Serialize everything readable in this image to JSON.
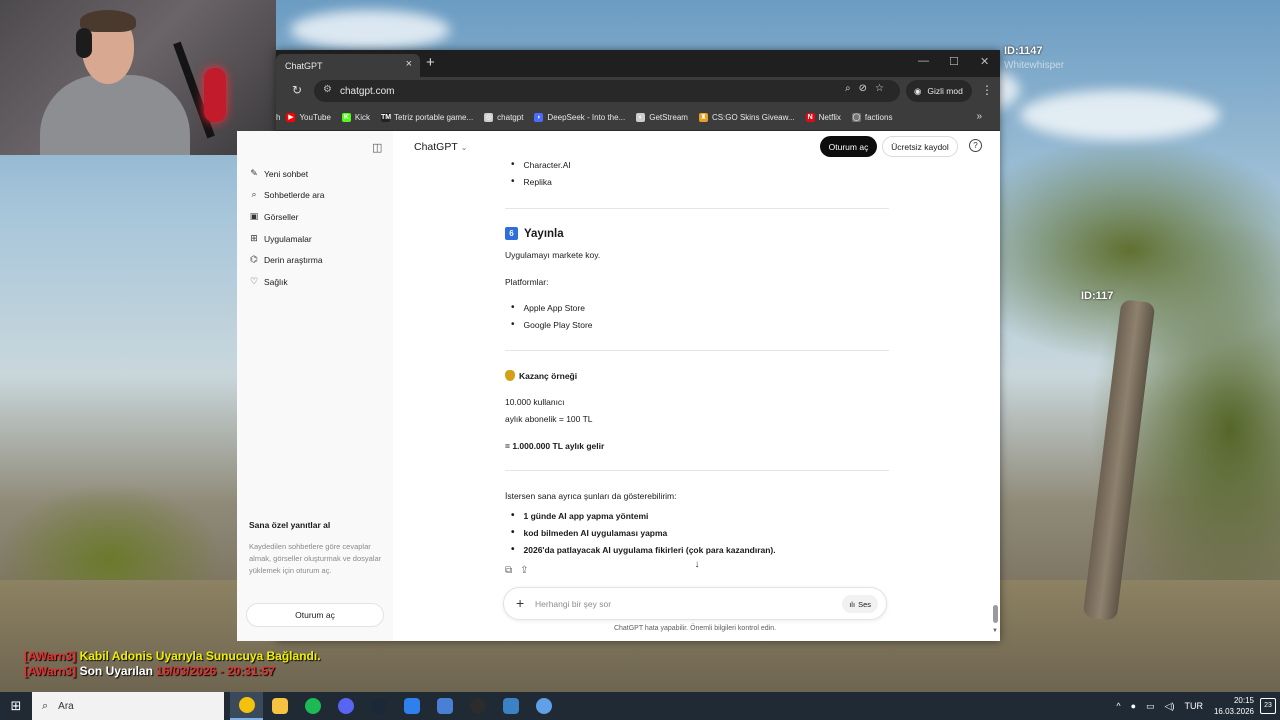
{
  "overlays": {
    "id_top": "ID:1147",
    "id_top_sub": "Whitewhisper",
    "id_right": "ID:117",
    "log_tag_1": "[AWarn3]",
    "log_msg_1": "Kabil Adonis Uyarıyla Sunucuya Bağlandı.",
    "log_tag_2": "[AWarn3]",
    "log_msg_2": "Son Uyarılan",
    "log_date_2": "16/03/2026 - 20:31:57"
  },
  "browser": {
    "tab_title": "ChatGPT",
    "url": "chatgpt.com",
    "incognito_label": "Gizli mod",
    "bookmarks": [
      {
        "label": "YouTube",
        "color": "#ff0000",
        "glyph": "▶"
      },
      {
        "label": "Kick",
        "color": "#53fc18",
        "glyph": "K"
      },
      {
        "label": "Tetriz portable game...",
        "color": "#222222",
        "glyph": "TM"
      },
      {
        "label": "chatgpt",
        "color": "#cccccc",
        "glyph": "◎"
      },
      {
        "label": "DeepSeek - Into the...",
        "color": "#4d6bfe",
        "glyph": "◗"
      },
      {
        "label": "GetStream",
        "color": "#cccccc",
        "glyph": "◐"
      },
      {
        "label": "CS:GO Skins Giveaw...",
        "color": "#e8a020",
        "glyph": "♜"
      },
      {
        "label": "Netflix",
        "color": "#e50914",
        "glyph": "N"
      },
      {
        "label": "factions",
        "color": "#777777",
        "glyph": "◯"
      }
    ]
  },
  "chatgpt": {
    "model": "ChatGPT",
    "login_button": "Oturum aç",
    "signup_button": "Ücretsiz kaydol",
    "sidebar": {
      "items": [
        {
          "label": "Yeni sohbet",
          "icon": "✎"
        },
        {
          "label": "Sohbetlerde ara",
          "icon": "⌕"
        },
        {
          "label": "Görseller",
          "icon": "▣"
        },
        {
          "label": "Uygulamalar",
          "icon": "⊞"
        },
        {
          "label": "Derin araştırma",
          "icon": "⌬"
        },
        {
          "label": "Sağlık",
          "icon": "♡"
        }
      ],
      "promo_title": "Sana özel yanıtlar al",
      "promo_text": "Kaydedilen sohbetlere göre cevaplar almak, görseller oluşturmak ve dosyalar yüklemek için oturum aç.",
      "login_button": "Oturum aç"
    },
    "message": {
      "top_bullets": [
        "Character.AI",
        "Replika"
      ],
      "section6_badge": "6",
      "section6_title": "Yayınla",
      "section6_text": "Uygulamayı markete koy.",
      "platforms_label": "Platformlar:",
      "platform_bullets": [
        "Apple App Store",
        "Google Play Store"
      ],
      "earnings_title": "Kazanç örneği",
      "earnings_line1": "10.000 kullanıcı",
      "earnings_line2": "aylık abonelik = 100 TL",
      "earnings_result": "= 1.000.000 TL aylık gelir",
      "offer_intro": "İstersen sana ayrıca şunları da gösterebilirim:",
      "offer_bullets": [
        "1 günde AI app yapma yöntemi",
        "kod bilmeden AI uygulaması yapma",
        "2026'da patlayacak AI uygulama fikirleri (çok para kazandıran)."
      ]
    },
    "composer_placeholder": "Herhangi bir şey sor",
    "voice_label": "Ses",
    "disclaimer": "ChatGPT hata yapabilir. Önemli bilgileri kontrol edin."
  },
  "taskbar": {
    "search_label": "Ara",
    "apps": [
      {
        "name": "chrome",
        "color": "#f4c20d"
      },
      {
        "name": "file-explorer",
        "color": "#f5c242"
      },
      {
        "name": "spotify",
        "color": "#1db954"
      },
      {
        "name": "discord",
        "color": "#5865f2"
      },
      {
        "name": "steam",
        "color": "#1b2838"
      },
      {
        "name": "vscode",
        "color": "#2f80ed"
      },
      {
        "name": "app-blue",
        "color": "#4a7fd6"
      },
      {
        "name": "app-dark",
        "color": "#2c2c2c"
      },
      {
        "name": "app-g",
        "color": "#3b82c4"
      },
      {
        "name": "app-round",
        "color": "#5fa0e8"
      }
    ],
    "lang": "TUR",
    "time": "20:15",
    "date": "16.03.2026",
    "notifications": "23"
  }
}
